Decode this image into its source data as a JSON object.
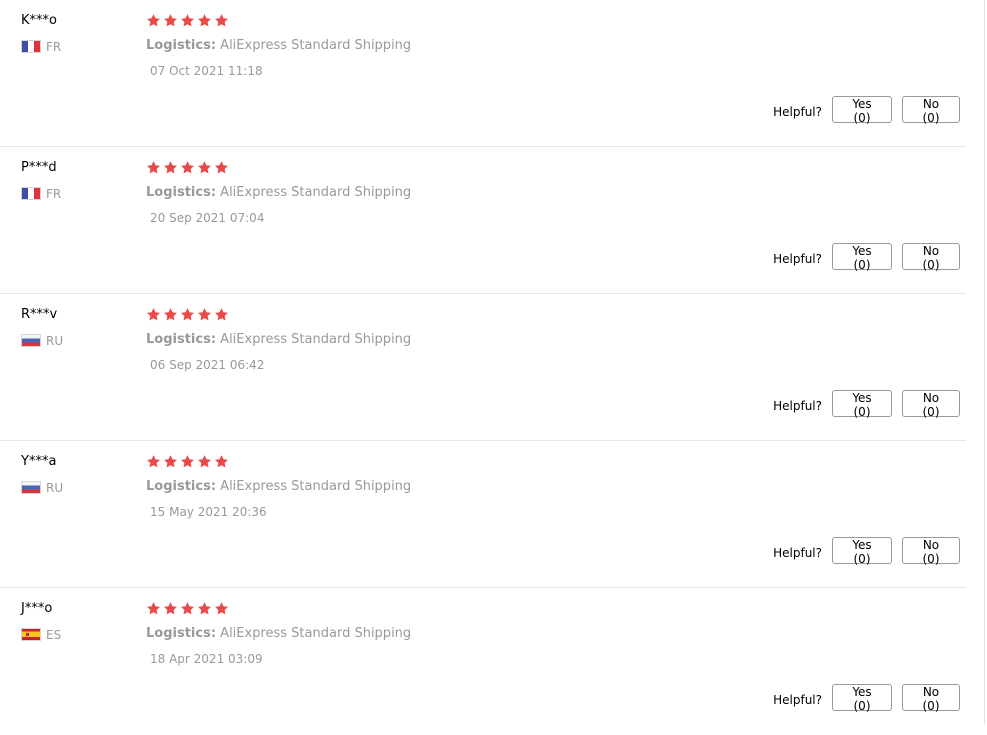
{
  "colors": {
    "star": "#e84a4a",
    "muted_text": "#999999",
    "divider": "#e6e6e6",
    "button_border": "#999999"
  },
  "review_common": {
    "logistics_label": "Logistics:",
    "logistics_value": "AliExpress Standard Shipping",
    "helpful_label": "Helpful?",
    "yes_label": "Yes (0)",
    "no_label": "No (0)"
  },
  "reviews": [
    {
      "user": "K***o",
      "country": "FR",
      "flag_icon": "flag-france-icon",
      "rating": 5,
      "date": "07 Oct 2021 11:18"
    },
    {
      "user": "P***d",
      "country": "FR",
      "flag_icon": "flag-france-icon",
      "rating": 5,
      "date": "20 Sep 2021 07:04"
    },
    {
      "user": "R***v",
      "country": "RU",
      "flag_icon": "flag-russia-icon",
      "rating": 5,
      "date": "06 Sep 2021 06:42"
    },
    {
      "user": "Y***a",
      "country": "RU",
      "flag_icon": "flag-russia-icon",
      "rating": 5,
      "date": "15 May 2021 20:36"
    },
    {
      "user": "J***o",
      "country": "ES",
      "flag_icon": "flag-spain-icon",
      "rating": 5,
      "date": "18 Apr 2021 03:09"
    }
  ]
}
